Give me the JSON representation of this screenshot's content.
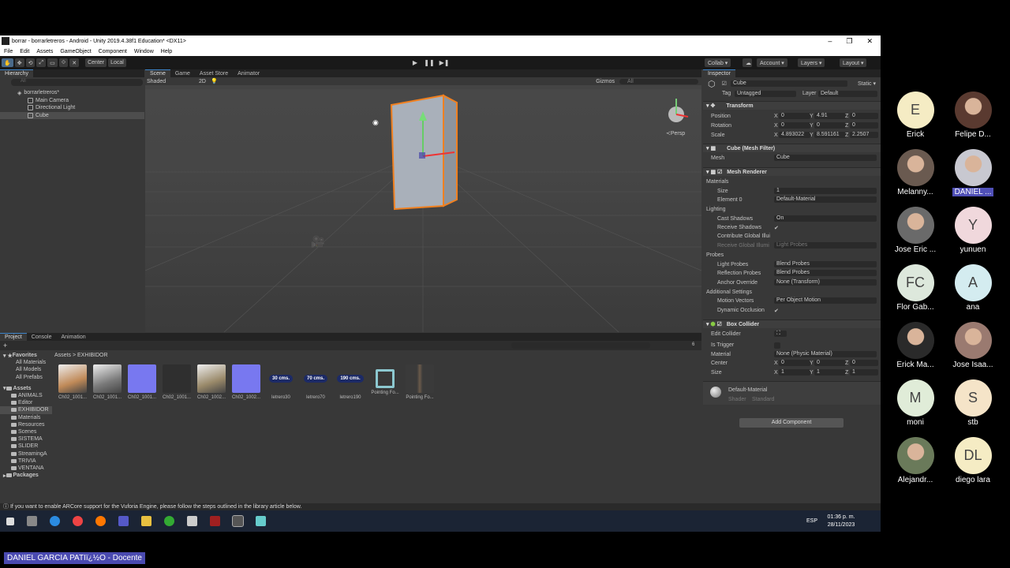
{
  "window": {
    "title": "borrar - borrarletreros - Android - Unity 2019.4.38f1 Education* <DX11>",
    "controls": [
      "–",
      "❐",
      "✕"
    ]
  },
  "menu": [
    "File",
    "Edit",
    "Assets",
    "GameObject",
    "Component",
    "Window",
    "Help"
  ],
  "toolbar": {
    "tools": [
      "✋",
      "✥",
      "⟲",
      "⤢",
      "▭",
      "⟐",
      "✕"
    ],
    "pivot": "Center",
    "space": "Local",
    "play": "▶",
    "pause": "❚❚",
    "step": "▶❚",
    "collab": "Collab ▾",
    "account": "Account ▾",
    "layers": "Layers ▾",
    "layout": "Layout ▾"
  },
  "hierarchy": {
    "tab": "Hierarchy",
    "search": "All",
    "scene_name": "borrarletreros*",
    "items": [
      "Main Camera",
      "Directional Light",
      "Cube"
    ]
  },
  "scene": {
    "tabs": [
      "Scene",
      "Game",
      "Asset Store",
      "Animator"
    ],
    "shading": "Shaded",
    "mode_2d": "2D",
    "gizmos": "Gizmos",
    "search": "All",
    "persp": "≺Persp"
  },
  "inspector": {
    "tab": "Inspector",
    "object_name": "Cube",
    "static_label": "Static ▾",
    "tag_label": "Tag",
    "tag_value": "Untagged",
    "layer_label": "Layer",
    "layer_value": "Default",
    "transform": {
      "title": "Transform",
      "position_label": "Position",
      "position": {
        "x": "0",
        "y": "4.91",
        "z": "0"
      },
      "rotation_label": "Rotation",
      "rotation": {
        "x": "0",
        "y": "0",
        "z": "0"
      },
      "scale_label": "Scale",
      "scale": {
        "x": "4.893022",
        "y": "8.591161",
        "z": "2.2507"
      }
    },
    "mesh_filter": {
      "title": "Cube (Mesh Filter)",
      "mesh_label": "Mesh",
      "mesh": "Cube"
    },
    "mesh_renderer": {
      "title": "Mesh Renderer",
      "materials": "Materials",
      "size_label": "Size",
      "size": "1",
      "element_label": "Element 0",
      "element": "Default-Material",
      "lighting": "Lighting",
      "cast_label": "Cast Shadows",
      "cast": "On",
      "receive_label": "Receive Shadows",
      "contribute_label": "Contribute Global Illui",
      "receive_gi_label": "Receive Global Illumi",
      "receive_gi": "Light Probes",
      "probes": "Probes",
      "light_probes_label": "Light Probes",
      "light_probes": "Blend Probes",
      "reflection_label": "Reflection Probes",
      "reflection": "Blend Probes",
      "anchor_label": "Anchor Override",
      "anchor": "None (Transform)",
      "additional": "Additional Settings",
      "motion_label": "Motion Vectors",
      "motion": "Per Object Motion",
      "dynamic_label": "Dynamic Occlusion"
    },
    "box_collider": {
      "title": "Box Collider",
      "edit_label": "Edit Collider",
      "trigger_label": "Is Trigger",
      "material_label": "Material",
      "material": "None (Physic Material)",
      "center_label": "Center",
      "center": {
        "x": "0",
        "y": "0",
        "z": "0"
      },
      "size_label": "Size",
      "size": {
        "x": "1",
        "y": "1",
        "z": "1"
      }
    },
    "material": {
      "name": "Default-Material",
      "shader_label": "Shader",
      "shader": "Standard"
    },
    "add_component": "Add Component"
  },
  "project": {
    "tabs": [
      "Project",
      "Console",
      "Animation"
    ],
    "breadcrumb": [
      "Assets",
      "EXHIBIDOR"
    ],
    "favorites_label": "Favorites",
    "favorites": [
      "All Materials",
      "All Models",
      "All Prefabs"
    ],
    "assets_label": "Assets",
    "folders": [
      "ANIMALS",
      "Editor",
      "EXHIBIDOR",
      "Materials",
      "Resources",
      "Scenes",
      "SISTEMA",
      "SLIDER",
      "StreamingA",
      "TRIVIA",
      "VENTANA"
    ],
    "packages_label": "Packages",
    "assets": [
      {
        "name": "Ch02_1001...",
        "kind": "photo",
        "color": "#c08a58"
      },
      {
        "name": "Ch02_1001...",
        "kind": "photo",
        "color": "#7a7a7a"
      },
      {
        "name": "Ch02_1001...",
        "kind": "solid",
        "color": "#7878f0"
      },
      {
        "name": "Ch02_1001...",
        "kind": "dark",
        "color": "#2f2f2f"
      },
      {
        "name": "Ch02_1002...",
        "kind": "photo",
        "color": "#9a8a6a"
      },
      {
        "name": "Ch02_1002...",
        "kind": "solid",
        "color": "#7878f0"
      },
      {
        "name": "letrero30",
        "kind": "pill",
        "color": "#1c2a66",
        "label": "30 cms."
      },
      {
        "name": "letrero70",
        "kind": "pill",
        "color": "#1c2a66",
        "label": "70 cms."
      },
      {
        "name": "letrero190",
        "kind": "pill",
        "color": "#1c2a66",
        "label": "190 cms."
      },
      {
        "name": "Pointing Fo...",
        "kind": "prefab",
        "color": "#8cc8d0"
      },
      {
        "name": "Pointing Fo...",
        "kind": "figure",
        "color": "#555555"
      }
    ],
    "count": "6"
  },
  "status": "If you want to enable ARCore support for the Vuforia Engine, please follow the steps outlined in the library article below.",
  "taskbar": {
    "lang": "ESP",
    "time": "01:36 p. m.",
    "date": "28/11/2023"
  },
  "participants": [
    {
      "initials": "E",
      "name": "Erick",
      "bg": "#f5ecc4",
      "photo": false
    },
    {
      "initials": "",
      "name": "Felipe D...",
      "bg": "#5a3a30",
      "photo": true
    },
    {
      "initials": "",
      "name": "Melanny...",
      "bg": "#6a5a50",
      "photo": true
    },
    {
      "initials": "",
      "name": "DANIEL ...",
      "bg": "#c8c8d0",
      "photo": true
    },
    {
      "initials": "",
      "name": "Jose Eric ...",
      "bg": "#6a6a6a",
      "photo": true
    },
    {
      "initials": "Y",
      "name": "yunuen",
      "bg": "#f0d8dc",
      "photo": false
    },
    {
      "initials": "FC",
      "name": "Flor Gab...",
      "bg": "#dde8dc",
      "photo": false
    },
    {
      "initials": "A",
      "name": "ana",
      "bg": "#d4ecf0",
      "photo": false
    },
    {
      "initials": "",
      "name": "Erick Ma...",
      "bg": "#2a2a2a",
      "photo": true
    },
    {
      "initials": "",
      "name": "Jose Isaa...",
      "bg": "#9a7a70",
      "photo": true
    },
    {
      "initials": "M",
      "name": "moni",
      "bg": "#e0ecd8",
      "photo": false
    },
    {
      "initials": "S",
      "name": "stb",
      "bg": "#f5e4c8",
      "photo": false
    },
    {
      "initials": "",
      "name": "Alejandr...",
      "bg": "#6a7a5a",
      "photo": true
    },
    {
      "initials": "DL",
      "name": "diego lara",
      "bg": "#f5ecc4",
      "photo": false
    }
  ],
  "presenter": "DANIEL GARCIA PATIï¿½O - Docente"
}
